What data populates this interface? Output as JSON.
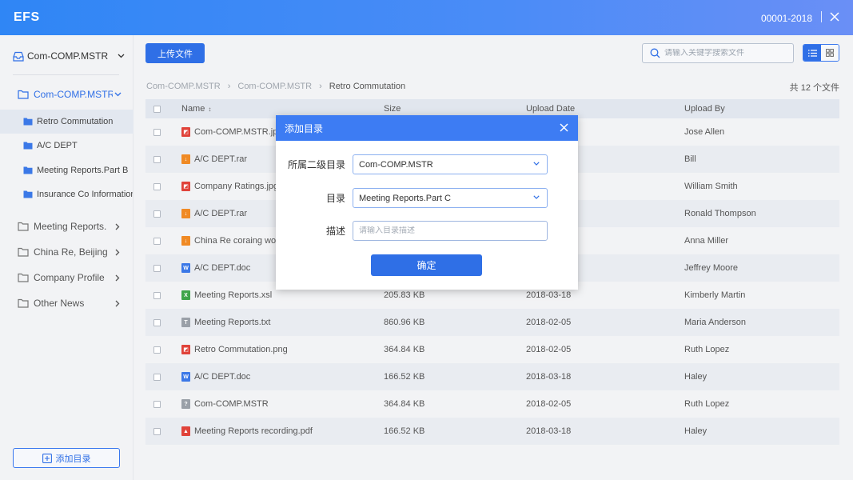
{
  "header": {
    "logo": "EFS",
    "account": "00001-2018"
  },
  "sidebar": {
    "top": "Com-COMP.MSTR",
    "active_folder": "Com-COMP.MSTR",
    "sub_items": [
      "Retro Commutation",
      "A/C DEPT",
      "Meeting Reports.Part B",
      "Insurance Co Information"
    ],
    "folders": [
      "Meeting Reports.",
      "China Re, Beijing",
      "Company Profile",
      "Other News"
    ],
    "add_dir": "添加目录"
  },
  "toolbar": {
    "upload": "上传文件",
    "search_placeholder": "请输入关键字搜索文件"
  },
  "breadcrumb": {
    "items": [
      "Com-COMP.MSTR",
      "Com-COMP.MSTR"
    ],
    "current": "Retro Commutation"
  },
  "total": "共 12 个文件",
  "table": {
    "headers": {
      "name": "Name",
      "size": "Size",
      "date": "Upload Date",
      "by": "Upload By"
    },
    "rows": [
      {
        "name": "Com-COMP.MSTR.jpg",
        "size": "",
        "date": "",
        "by": "Jose Allen",
        "type": "img"
      },
      {
        "name": "A/C DEPT.rar",
        "size": "",
        "date": "",
        "by": "Bill",
        "type": "rar"
      },
      {
        "name": "Company Ratings.jpg",
        "size": "",
        "date": "",
        "by": "William Smith",
        "type": "img"
      },
      {
        "name": "A/C DEPT.rar",
        "size": "",
        "date": "",
        "by": "Ronald Thompson",
        "type": "rar"
      },
      {
        "name": "China Re coraing wor",
        "size": "",
        "date": "",
        "by": "Anna Miller",
        "type": "rar"
      },
      {
        "name": "A/C DEPT.doc",
        "size": "",
        "date": "",
        "by": "Jeffrey Moore",
        "type": "doc"
      },
      {
        "name": "Meeting Reports.xsl",
        "size": "205.83 KB",
        "date": "2018-03-18",
        "by": "Kimberly Martin",
        "type": "xls"
      },
      {
        "name": "Meeting Reports.txt",
        "size": "860.96 KB",
        "date": "2018-02-05",
        "by": "Maria Anderson",
        "type": "txt"
      },
      {
        "name": "Retro Commutation.png",
        "size": "364.84 KB",
        "date": "2018-02-05",
        "by": "Ruth Lopez",
        "type": "img"
      },
      {
        "name": "A/C DEPT.doc",
        "size": "166.52 KB",
        "date": "2018-03-18",
        "by": "Haley",
        "type": "doc"
      },
      {
        "name": "Com-COMP.MSTR",
        "size": "364.84 KB",
        "date": "2018-02-05",
        "by": "Ruth Lopez",
        "type": "unk"
      },
      {
        "name": "Meeting Reports recording.pdf",
        "size": "166.52 KB",
        "date": "2018-03-18",
        "by": "Haley",
        "type": "pdf"
      }
    ]
  },
  "modal": {
    "title": "添加目录",
    "parent_label": "所属二级目录",
    "parent_value": "Com-COMP.MSTR",
    "dir_label": "目录",
    "dir_value": "Meeting Reports.Part C",
    "desc_label": "描述",
    "desc_placeholder": "请输入目录描述",
    "confirm": "确定"
  },
  "colors": {
    "primary": "#2f6fe6",
    "img": "#e0433a",
    "rar": "#f08a24",
    "doc": "#3b78e7",
    "xls": "#3fa54a",
    "txt": "#9aa0a8",
    "unk": "#9aa0a8",
    "pdf": "#e0433a"
  },
  "icons": {
    "header_close": "close-icon",
    "inbox": "inbox-icon",
    "folder": "folder-icon",
    "search": "search-icon",
    "list_view": "list-view-icon",
    "grid_view": "grid-view-icon",
    "plus_box": "plus-square-icon"
  }
}
